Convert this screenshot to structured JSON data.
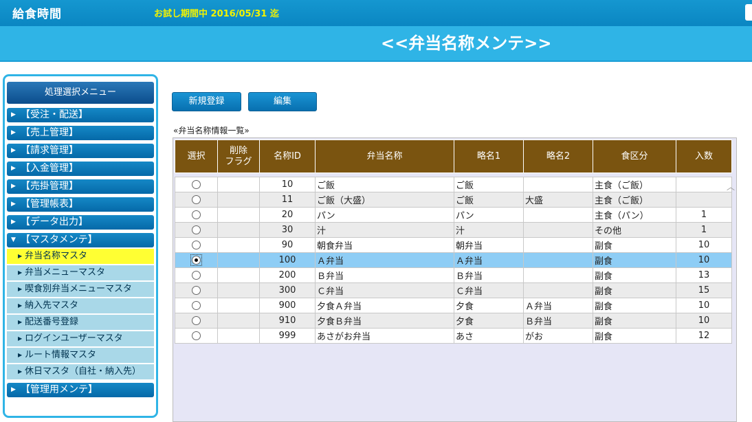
{
  "header": {
    "app_title": "給食時間",
    "trial_notice": "お試し期間中 2016/05/31 迄",
    "page_title": "<<弁当名称メンテ>>"
  },
  "sidebar": {
    "header": "処理選択メニュー",
    "categories": [
      {
        "label": "【受注・配送】"
      },
      {
        "label": "【売上管理】"
      },
      {
        "label": "【請求管理】"
      },
      {
        "label": "【入金管理】"
      },
      {
        "label": "【売掛管理】"
      },
      {
        "label": "【管理帳表】"
      },
      {
        "label": "【データ出力】"
      },
      {
        "label": "【マスタメンテ】"
      },
      {
        "label": "【管理用メンテ】"
      }
    ],
    "subitems": [
      {
        "label": "弁当名称マスタ"
      },
      {
        "label": "弁当メニューマスタ"
      },
      {
        "label": "喫食別弁当メニューマスタ"
      },
      {
        "label": "納入先マスタ"
      },
      {
        "label": "配送番号登録"
      },
      {
        "label": "ログインユーザーマスタ"
      },
      {
        "label": "ルート情報マスタ"
      },
      {
        "label": "休日マスタ（自社・納入先）"
      }
    ],
    "active_subitem": "弁当名称マスタ"
  },
  "toolbar": {
    "new_label": "新規登録",
    "edit_label": "編集"
  },
  "list": {
    "caption": "«弁当名称情報一覧»",
    "headers": {
      "select": "選択",
      "delete_flag_1": "削除",
      "delete_flag_2": "フラグ",
      "name_id": "名称ID",
      "name": "弁当名称",
      "abbr1": "略名1",
      "abbr2": "略名2",
      "category": "食区分",
      "quantity": "入数"
    },
    "rows": [
      {
        "id": "10",
        "name": "ご飯",
        "abbr1": "ご飯",
        "abbr2": "",
        "category": "主食（ご飯）",
        "qty": ""
      },
      {
        "id": "11",
        "name": "ご飯（大盛）",
        "abbr1": "ご飯",
        "abbr2": "大盛",
        "category": "主食（ご飯）",
        "qty": ""
      },
      {
        "id": "20",
        "name": "パン",
        "abbr1": "パン",
        "abbr2": "",
        "category": "主食（パン）",
        "qty": "1"
      },
      {
        "id": "30",
        "name": "汁",
        "abbr1": "汁",
        "abbr2": "",
        "category": "その他",
        "qty": "1"
      },
      {
        "id": "90",
        "name": "朝食弁当",
        "abbr1": "朝弁当",
        "abbr2": "",
        "category": "副食",
        "qty": "10"
      },
      {
        "id": "100",
        "name": "Ａ弁当",
        "abbr1": "Ａ弁当",
        "abbr2": "",
        "category": "副食",
        "qty": "10"
      },
      {
        "id": "200",
        "name": "Ｂ弁当",
        "abbr1": "Ｂ弁当",
        "abbr2": "",
        "category": "副食",
        "qty": "13"
      },
      {
        "id": "300",
        "name": "Ｃ弁当",
        "abbr1": "Ｃ弁当",
        "abbr2": "",
        "category": "副食",
        "qty": "15"
      },
      {
        "id": "900",
        "name": "夕食Ａ弁当",
        "abbr1": "夕食",
        "abbr2": "Ａ弁当",
        "category": "副食",
        "qty": "10"
      },
      {
        "id": "910",
        "name": "夕食Ｂ弁当",
        "abbr1": "夕食",
        "abbr2": "Ｂ弁当",
        "category": "副食",
        "qty": "10"
      },
      {
        "id": "999",
        "name": "あさがお弁当",
        "abbr1": "あさ",
        "abbr2": "がお",
        "category": "副食",
        "qty": "12"
      }
    ],
    "selected_row_index": 5
  }
}
